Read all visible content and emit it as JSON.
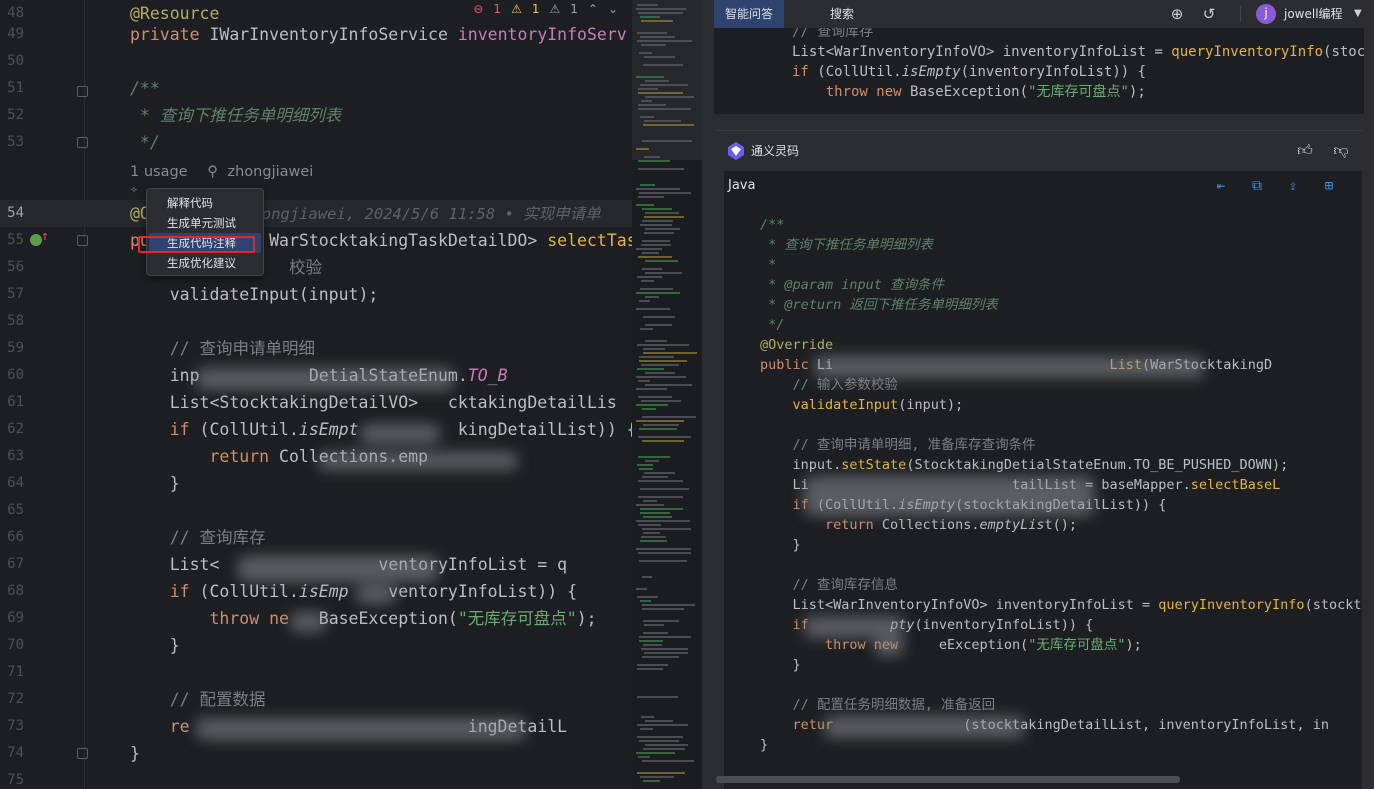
{
  "editor": {
    "inspections": {
      "errors": "1",
      "warnings": "1",
      "weak_warnings": "1"
    },
    "lines": [
      {
        "num": "48",
        "segments": [
          {
            "t": "@Resource",
            "c": "ann"
          }
        ]
      },
      {
        "num": "49",
        "segments": [
          {
            "t": "private ",
            "c": "kw"
          },
          {
            "t": "IWarInventoryInfoService ",
            "c": ""
          },
          {
            "t": "inventoryInfoServ",
            "c": "fld"
          }
        ]
      },
      {
        "num": "50",
        "segments": []
      },
      {
        "num": "51",
        "segments": [
          {
            "t": "/**",
            "c": "doc"
          }
        ]
      },
      {
        "num": "52",
        "segments": [
          {
            "t": " * 查询下推任务单明细列表",
            "c": "doc"
          }
        ]
      },
      {
        "num": "53",
        "segments": [
          {
            "t": " */",
            "c": "doc"
          }
        ]
      },
      {
        "num": "54",
        "segments": [
          {
            "t": "@O",
            "c": "ann"
          },
          {
            "t": "           hongjiawei, 2024/5/6 11:58 • 实现申请单",
            "c": "blame"
          }
        ]
      },
      {
        "num": "55",
        "segments": [
          {
            "t": "pu",
            "c": "kw"
          },
          {
            "t": "            WarStocktakingTaskDetailDO> ",
            "c": ""
          },
          {
            "t": "selectTask",
            "c": "rc-fn"
          }
        ]
      },
      {
        "num": "56",
        "segments": [
          {
            "t": "                校验",
            "c": "cmt"
          }
        ]
      },
      {
        "num": "57",
        "segments": [
          {
            "t": "    validateInput(input);",
            "c": ""
          }
        ]
      },
      {
        "num": "58",
        "segments": []
      },
      {
        "num": "59",
        "segments": [
          {
            "t": "    // 查询申请单明细",
            "c": "cmt"
          }
        ]
      },
      {
        "num": "60",
        "segments": [
          {
            "t": "    inp",
            "c": ""
          },
          {
            "t": "           ",
            "c": ""
          },
          {
            "t": "DetialStateEnum.",
            "c": ""
          },
          {
            "t": "TO_B",
            "c": "stat"
          }
        ]
      },
      {
        "num": "61",
        "segments": [
          {
            "t": "    List<StocktakingDetailVO> ",
            "c": ""
          },
          {
            "t": "  cktakingDetailLis",
            "c": ""
          }
        ]
      },
      {
        "num": "62",
        "segments": [
          {
            "t": "    if ",
            "c": "kw"
          },
          {
            "t": "(CollUtil.",
            "c": ""
          },
          {
            "t": "isEmpt",
            "c": "ital"
          },
          {
            "t": "          kingDetailList)) {",
            "c": ""
          }
        ]
      },
      {
        "num": "63",
        "segments": [
          {
            "t": "        return ",
            "c": "kw"
          },
          {
            "t": "Collections.emp",
            "c": ""
          }
        ]
      },
      {
        "num": "64",
        "segments": [
          {
            "t": "    }",
            "c": ""
          }
        ]
      },
      {
        "num": "65",
        "segments": []
      },
      {
        "num": "66",
        "segments": [
          {
            "t": "    // 查询库存",
            "c": "cmt"
          }
        ]
      },
      {
        "num": "67",
        "segments": [
          {
            "t": "    List<",
            "c": ""
          },
          {
            "t": "                ",
            "c": ""
          },
          {
            "t": "ventoryInfoList = q",
            "c": ""
          }
        ]
      },
      {
        "num": "68",
        "segments": [
          {
            "t": "    if ",
            "c": "kw"
          },
          {
            "t": "(CollUtil.",
            "c": ""
          },
          {
            "t": "isEmp",
            "c": "ital"
          },
          {
            "t": "    ventoryInfoList)) {",
            "c": ""
          }
        ]
      },
      {
        "num": "69",
        "segments": [
          {
            "t": "        throw ",
            "c": "kw"
          },
          {
            "t": "ne",
            "c": "kw"
          },
          {
            "t": "   BaseException(",
            "c": ""
          },
          {
            "t": "\"无库存可盘点\"",
            "c": "str"
          },
          {
            "t": ");",
            "c": ""
          }
        ]
      },
      {
        "num": "70",
        "segments": [
          {
            "t": "    }",
            "c": ""
          }
        ]
      },
      {
        "num": "71",
        "segments": []
      },
      {
        "num": "72",
        "segments": [
          {
            "t": "    // 配置数据",
            "c": "cmt"
          }
        ]
      },
      {
        "num": "73",
        "segments": [
          {
            "t": "    re",
            "c": "kw"
          },
          {
            "t": "                            ingDetailL",
            "c": ""
          }
        ]
      },
      {
        "num": "74",
        "segments": [
          {
            "t": "}",
            "c": ""
          }
        ]
      },
      {
        "num": "75",
        "segments": []
      }
    ],
    "usage_hint": {
      "count": "1 usage",
      "author": "zhongjiawei"
    },
    "context_menu": {
      "items": [
        "解释代码",
        "生成单元测试",
        "生成代码注释",
        "生成优化建议"
      ],
      "selected_index": 2
    }
  },
  "right_panel": {
    "tabs": [
      "智能问答",
      "搜索"
    ],
    "active_tab": "智能问答",
    "user": {
      "avatar_letter": "j",
      "name": "jowell编程"
    },
    "previous_code": [
      [
        {
          "t": "// 查询库存",
          "c": "cmt"
        }
      ],
      [
        {
          "t": "List<WarInventoryInfoVO> inventoryInfoList = ",
          "c": ""
        },
        {
          "t": "queryInventoryInfo",
          "c": "rc-fn"
        },
        {
          "t": "(stocktak",
          "c": ""
        }
      ],
      [
        {
          "t": "if ",
          "c": "kw"
        },
        {
          "t": "(CollUtil.",
          "c": ""
        },
        {
          "t": "isEmpty",
          "c": "ital"
        },
        {
          "t": "(inventoryInfoList)) {",
          "c": ""
        }
      ],
      [
        {
          "t": "    throw new ",
          "c": "kw"
        },
        {
          "t": "BaseException(",
          "c": ""
        },
        {
          "t": "\"无库存可盘点\"",
          "c": "str"
        },
        {
          "t": ");",
          "c": ""
        }
      ]
    ],
    "assistant_name": "通义灵码",
    "code_language": "Java",
    "response_code": [
      [
        {
          "t": "/**",
          "c": "doc"
        }
      ],
      [
        {
          "t": " * 查询下推任务单明细列表",
          "c": "doc"
        }
      ],
      [
        {
          "t": " *",
          "c": "doc"
        }
      ],
      [
        {
          "t": " * @param input 查询条件",
          "c": "doc"
        }
      ],
      [
        {
          "t": " * @return 返回下推任务单明细列表",
          "c": "doc"
        }
      ],
      [
        {
          "t": " */",
          "c": "doc"
        }
      ],
      [
        {
          "t": "@Override",
          "c": "ann"
        }
      ],
      [
        {
          "t": "public ",
          "c": "kw"
        },
        {
          "t": "Li",
          "c": ""
        },
        {
          "t": "                                  ",
          "c": ""
        },
        {
          "t": "List",
          "c": "rc-fn"
        },
        {
          "t": "(WarStocktakingD",
          "c": ""
        }
      ],
      [
        {
          "t": "    // 输入参数校验",
          "c": "cmt"
        }
      ],
      [
        {
          "t": "    ",
          "c": ""
        },
        {
          "t": "validateInput",
          "c": "rc-fn"
        },
        {
          "t": "(input);",
          "c": ""
        }
      ],
      [],
      [
        {
          "t": "    // 查询申请单明细, 准备库存查询条件",
          "c": "cmt"
        }
      ],
      [
        {
          "t": "    input.",
          "c": ""
        },
        {
          "t": "setState",
          "c": "rc-fn"
        },
        {
          "t": "(StocktakingDetialStateEnum.TO_BE_PUSHED_DOWN);",
          "c": ""
        }
      ],
      [
        {
          "t": "    Li",
          "c": ""
        },
        {
          "t": "                         ",
          "c": ""
        },
        {
          "t": "tailList = baseMapper.",
          "c": ""
        },
        {
          "t": "selectBaseL",
          "c": "rc-fn"
        }
      ],
      [
        {
          "t": "    if ",
          "c": "kw"
        },
        {
          "t": "(CollUtil.",
          "c": ""
        },
        {
          "t": "isEmpty",
          "c": "ital"
        },
        {
          "t": "(stocktakin",
          "c": ""
        },
        {
          "t": "gDetailList)) {",
          "c": ""
        }
      ],
      [
        {
          "t": "        return ",
          "c": "kw"
        },
        {
          "t": "Collections.",
          "c": ""
        },
        {
          "t": "emptyLis",
          "c": "ital"
        },
        {
          "t": "t();",
          "c": ""
        }
      ],
      [
        {
          "t": "    }",
          "c": ""
        }
      ],
      [],
      [
        {
          "t": "    // 查询库存信息",
          "c": "cmt"
        }
      ],
      [
        {
          "t": "    List<WarInventoryInfoVO> inventoryInfoList = ",
          "c": ""
        },
        {
          "t": "queryInventoryInfo",
          "c": "rc-fn"
        },
        {
          "t": "(stocktak",
          "c": ""
        }
      ],
      [
        {
          "t": "    if ",
          "c": "kw"
        },
        {
          "t": "         ",
          "c": ""
        },
        {
          "t": "pty",
          "c": "ital"
        },
        {
          "t": "(inventoryInfoList)) {",
          "c": ""
        }
      ],
      [
        {
          "t": "        throw new ",
          "c": "kw"
        },
        {
          "t": "    ",
          "c": ""
        },
        {
          "t": "eException(",
          "c": ""
        },
        {
          "t": "\"无库存可盘点\"",
          "c": "str"
        },
        {
          "t": ");",
          "c": ""
        }
      ],
      [
        {
          "t": "    }",
          "c": ""
        }
      ],
      [],
      [
        {
          "t": "    // 配置任务明细数据, 准备返回",
          "c": "cmt"
        }
      ],
      [
        {
          "t": "    retur",
          "c": "kw"
        },
        {
          "t": "                ",
          "c": ""
        },
        {
          "t": "(stocktakingDetailList, inventoryInfoList, in",
          "c": ""
        }
      ],
      [
        {
          "t": "}",
          "c": ""
        }
      ]
    ]
  },
  "colors": {
    "editor_bg": "#1e1f22",
    "panel_bg": "#2b2d30",
    "keyword": "#cf8e6d",
    "annotation": "#b3ae60",
    "doc_comment": "#5f826b",
    "string": "#6aab73",
    "method": "#e2b346",
    "menu_selected": "#2e436e",
    "highlight_box": "#e8252a"
  },
  "icons": [
    "error-icon",
    "warning-icon",
    "weak-warning-icon",
    "arrow-up-icon",
    "arrow-down-icon",
    "add-icon",
    "history-icon",
    "chevron-down-icon",
    "lingma-logo-icon",
    "thumb-up-icon",
    "thumb-down-icon",
    "insert-code-icon",
    "copy-icon",
    "new-file-icon",
    "add-snippet-icon",
    "fold-icon",
    "override-marker-icon",
    "ai-sparkle-icon"
  ]
}
